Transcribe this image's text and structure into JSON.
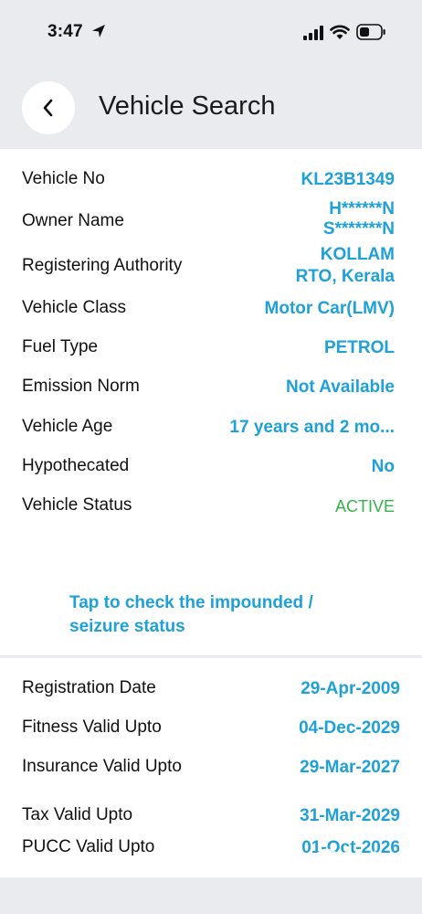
{
  "status_bar": {
    "time": "3:47"
  },
  "header": {
    "title": "Vehicle Search"
  },
  "vehicle_details": {
    "vehicle_no": {
      "label": "Vehicle No",
      "value": "KL23B1349"
    },
    "owner_name": {
      "label": "Owner Name",
      "value_line1": "H******N",
      "value_line2": "S*******N"
    },
    "registering_authority": {
      "label": "Registering Authority",
      "value_line1": "KOLLAM",
      "value_line2": "RTO, Kerala"
    },
    "vehicle_class": {
      "label": "Vehicle Class",
      "value": "Motor Car(LMV)"
    },
    "fuel_type": {
      "label": "Fuel Type",
      "value": "PETROL"
    },
    "emission_norm": {
      "label": "Emission Norm",
      "value": "Not Available"
    },
    "vehicle_age": {
      "label": "Vehicle Age",
      "value": "17 years and 2 mo..."
    },
    "hypothecated": {
      "label": "Hypothecated",
      "value": "No"
    },
    "vehicle_status": {
      "label": "Vehicle Status",
      "value": "ACTIVE"
    }
  },
  "impound_link": {
    "line1": "Tap to check the impounded /",
    "line2": "seizure status"
  },
  "validity": {
    "registration_date": {
      "label": "Registration Date",
      "value": "29-Apr-2009"
    },
    "fitness_valid_upto": {
      "label": "Fitness Valid Upto",
      "value": "04-Dec-2029"
    },
    "insurance_valid_upto": {
      "label": "Insurance Valid Upto",
      "value": "29-Mar-2027"
    },
    "tax_valid_upto": {
      "label": "Tax Valid Upto",
      "value": "31-Mar-2029"
    },
    "pucc_valid_upto": {
      "label": "PUCC Valid Upto",
      "value": "01-Oct-2026"
    }
  },
  "colors": {
    "accent": "#1ea0d8",
    "active": "#34b34a",
    "background": "#e9ebee"
  },
  "icons": [
    "location-arrow-icon",
    "signal-icon",
    "wifi-icon",
    "battery-icon",
    "chevron-left-icon",
    "olx-logo"
  ]
}
